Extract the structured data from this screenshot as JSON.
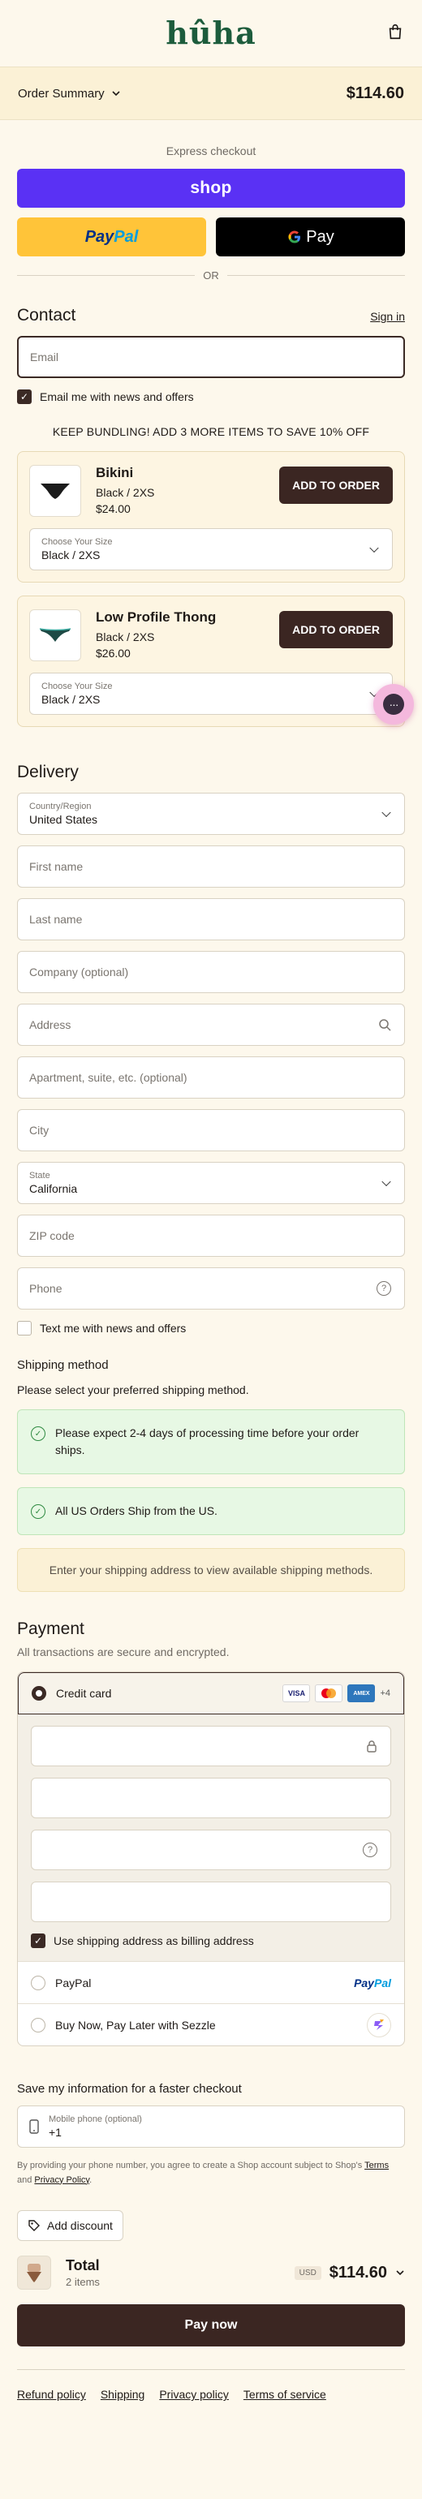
{
  "header": {
    "logo": "hûha",
    "bag_icon": "shopping-bag-icon"
  },
  "summary": {
    "label": "Order Summary",
    "total": "$114.60"
  },
  "express": {
    "label": "Express checkout",
    "shop_label": "shop",
    "paypal_part1": "Pay",
    "paypal_part2": "Pal",
    "gpay_label": "Pay",
    "or": "OR"
  },
  "contact": {
    "title": "Contact",
    "sign_in": "Sign in",
    "email_placeholder": "Email",
    "news_label": "Email me with news and offers"
  },
  "promo": "KEEP BUNDLING! ADD 3 MORE ITEMS TO SAVE 10% OFF",
  "upsells": [
    {
      "name": "Bikini",
      "variant": "Black / 2XS",
      "price": "$24.00",
      "button": "ADD TO ORDER",
      "size_label": "Choose Your Size",
      "size_value": "Black / 2XS"
    },
    {
      "name": "Low Profile Thong",
      "variant": "Black / 2XS",
      "price": "$26.00",
      "button": "ADD TO ORDER",
      "size_label": "Choose Your Size",
      "size_value": "Black / 2XS"
    }
  ],
  "chat_icon": "chat-bubble-icon",
  "delivery": {
    "title": "Delivery",
    "country_label": "Country/Region",
    "country_value": "United States",
    "first_name": "First name",
    "last_name": "Last name",
    "company": "Company (optional)",
    "address": "Address",
    "apartment": "Apartment, suite, etc. (optional)",
    "city": "City",
    "state_label": "State",
    "state_value": "California",
    "zip": "ZIP code",
    "phone": "Phone",
    "text_me": "Text me with news and offers"
  },
  "shipping": {
    "title": "Shipping method",
    "note": "Please select your preferred shipping method.",
    "banner1": "Please expect 2-4 days of processing time before your order ships.",
    "banner2": "All US Orders Ship from the US.",
    "address_prompt": "Enter your shipping address to view available shipping methods."
  },
  "payment": {
    "title": "Payment",
    "subtitle": "All transactions are secure and encrypted.",
    "credit_card": "Credit card",
    "card_logos": [
      "VISA",
      "MC",
      "AMEX"
    ],
    "more_cards": "+4",
    "billing_same": "Use shipping address as billing address",
    "paypal": "PayPal",
    "sezzle": "Buy Now, Pay Later with Sezzle"
  },
  "save_info": {
    "title": "Save my information for a faster checkout",
    "phone_label": "Mobile phone (optional)",
    "phone_value": "+1",
    "legal_prefix": "By providing your phone number, you agree to create a Shop account subject to Shop's",
    "terms": "Terms",
    "and": "and",
    "privacy": "Privacy Policy",
    "period": "."
  },
  "discount": {
    "label": "Add discount"
  },
  "total": {
    "label": "Total",
    "items": "2 items",
    "currency": "USD",
    "amount": "$114.60"
  },
  "pay_now": "Pay now",
  "footer": {
    "refund": "Refund policy",
    "shipping": "Shipping",
    "privacy": "Privacy policy",
    "terms": "Terms of service"
  }
}
